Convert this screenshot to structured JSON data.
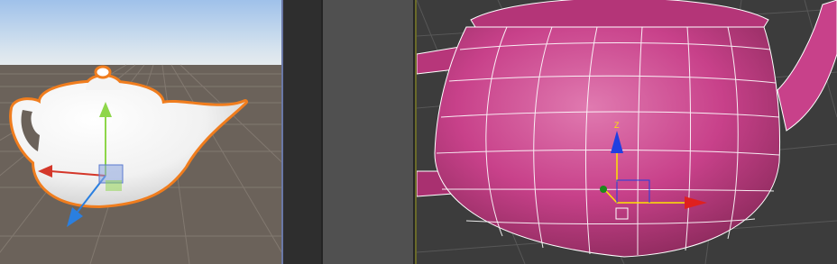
{
  "unity_viewport": {
    "colors": {
      "sky_top": "#9fc1ea",
      "sky_horizon": "#dfe8ef",
      "ground": "#6b625a",
      "grid": "#8a8178",
      "selection_outline": "#f07d1e",
      "teapot": "#ffffff"
    },
    "gizmo": {
      "y_axis_color": "#8ed64a",
      "x_axis_color": "#d4372a",
      "z_axis_color": "#2a7fe0",
      "plane_handle_color": "#8aa4de"
    }
  },
  "max_viewport": {
    "colors": {
      "background": "#3c3c3c",
      "grid": "#575757",
      "teapot": "#c8418a",
      "wireframe": "#ffffff"
    },
    "gizmo": {
      "z_label": "Z",
      "z_axis_color": "#1f3fe0",
      "x_axis_color": "#e0201f",
      "y_axis_color": "#1b8a1b",
      "pivot_color": "#ffe400"
    }
  },
  "panels": {
    "middle_panel_color": "#505050",
    "gap_color": "#2e2e2e"
  }
}
